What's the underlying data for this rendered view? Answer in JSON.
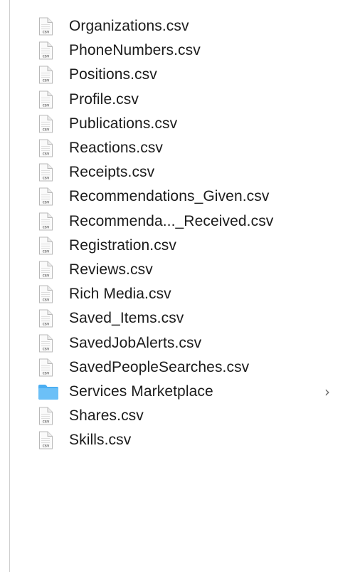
{
  "files": [
    {
      "name": "Organizations.csv",
      "icon": "csv-file-icon",
      "badge": "csv"
    },
    {
      "name": "PhoneNumbers.csv",
      "icon": "csv-file-icon",
      "badge": "csv"
    },
    {
      "name": "Positions.csv",
      "icon": "csv-file-icon",
      "badge": "csv"
    },
    {
      "name": "Profile.csv",
      "icon": "csv-file-icon",
      "badge": "csv"
    },
    {
      "name": "Publications.csv",
      "icon": "csv-file-icon",
      "badge": "csv"
    },
    {
      "name": "Reactions.csv",
      "icon": "csv-file-icon",
      "badge": "csv"
    },
    {
      "name": "Receipts.csv",
      "icon": "csv-file-icon",
      "badge": "csv"
    },
    {
      "name": "Recommendations_Given.csv",
      "icon": "csv-file-icon",
      "badge": "csv"
    },
    {
      "name": "Recommenda..._Received.csv",
      "icon": "csv-file-icon",
      "badge": "csv"
    },
    {
      "name": "Registration.csv",
      "icon": "csv-file-icon",
      "badge": "csv"
    },
    {
      "name": "Reviews.csv",
      "icon": "csv-file-icon",
      "badge": "csv"
    },
    {
      "name": "Rich Media.csv",
      "icon": "csv-file-icon",
      "badge": "csv"
    },
    {
      "name": "Saved_Items.csv",
      "icon": "csv-file-icon",
      "badge": "csv"
    },
    {
      "name": "SavedJobAlerts.csv",
      "icon": "csv-file-icon",
      "badge": "csv"
    },
    {
      "name": "SavedPeopleSearches.csv",
      "icon": "csv-file-icon",
      "badge": "csv"
    },
    {
      "name": "Services Marketplace",
      "icon": "folder-icon",
      "chevron": "›"
    },
    {
      "name": "Shares.csv",
      "icon": "csv-file-icon",
      "badge": "csv"
    },
    {
      "name": "Skills.csv",
      "icon": "csv-file-icon",
      "badge": "csv"
    }
  ],
  "colors": {
    "folder": "#4aaef2",
    "text": "#1b1b1b",
    "file_outline": "#b9b9b9"
  }
}
